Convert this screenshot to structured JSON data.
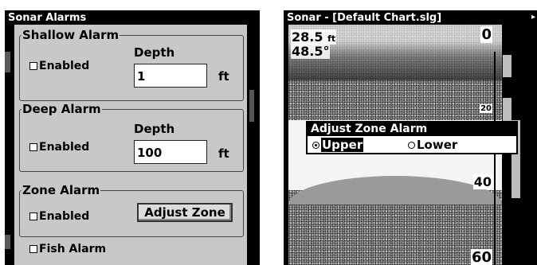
{
  "alarms_dialog": {
    "title": "Sonar Alarms",
    "shallow": {
      "legend": "Shallow Alarm",
      "enabled_label": "Enabled",
      "depth_label": "Depth",
      "value": "1",
      "unit": "ft"
    },
    "deep": {
      "legend": "Deep Alarm",
      "enabled_label": "Enabled",
      "depth_label": "Depth",
      "value": "100",
      "unit": "ft"
    },
    "zone": {
      "legend": "Zone Alarm",
      "enabled_label": "Enabled",
      "button": "Adjust Zone"
    },
    "fish": {
      "label": "Fish Alarm"
    }
  },
  "sonar": {
    "title": "Sonar - [Default Chart.slg]",
    "readouts": {
      "depth": "28.5",
      "depth_unit": "ft",
      "temp": "48.5°"
    },
    "scale": [
      "0",
      "20",
      "40",
      "60"
    ],
    "adjust_dialog": {
      "title": "Adjust Zone Alarm",
      "upper": "Upper",
      "lower": "Lower",
      "selected": "upper"
    }
  },
  "colors": {
    "screen": "#000000",
    "dialog_bg": "#c8c8c8",
    "panel_text": "#ffffff"
  }
}
